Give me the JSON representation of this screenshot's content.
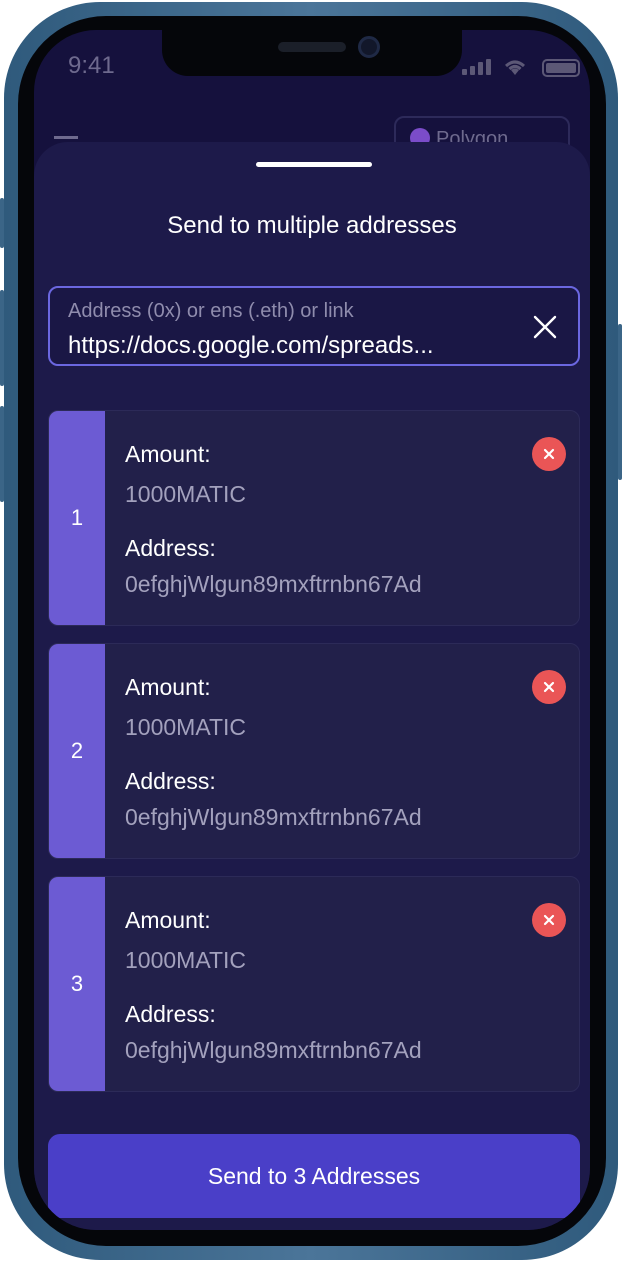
{
  "status_bar": {
    "time": "9:41",
    "icons": [
      "signal-icon",
      "wifi-icon",
      "battery-icon"
    ]
  },
  "background": {
    "network": "Polygon"
  },
  "sheet": {
    "title": "Send to multiple addresses",
    "address_input": {
      "placeholder": "Address (0x) or ens (.eth) or  link",
      "value": "https://docs.google.com/spreads..."
    },
    "recipients": [
      {
        "index": "1",
        "amount_label": "Amount:",
        "amount": "1000MATIC",
        "address_label": "Address:",
        "address": "0efghjWlgun89mxftrnbn67Ad"
      },
      {
        "index": "2",
        "amount_label": "Amount:",
        "amount": "1000MATIC",
        "address_label": "Address:",
        "address": "0efghjWlgun89mxftrnbn67Ad"
      },
      {
        "index": "3",
        "amount_label": "Amount:",
        "amount": "1000MATIC",
        "address_label": "Address:",
        "address": "0efghjWlgun89mxftrnbn67Ad"
      }
    ],
    "send_button": "Send to 3 Addresses"
  },
  "colors": {
    "sheet_bg": "#1d1a4a",
    "accent": "#6c5bd3",
    "button": "#4a3fc8",
    "remove": "#ea5556",
    "input_border": "#6b67e0"
  }
}
